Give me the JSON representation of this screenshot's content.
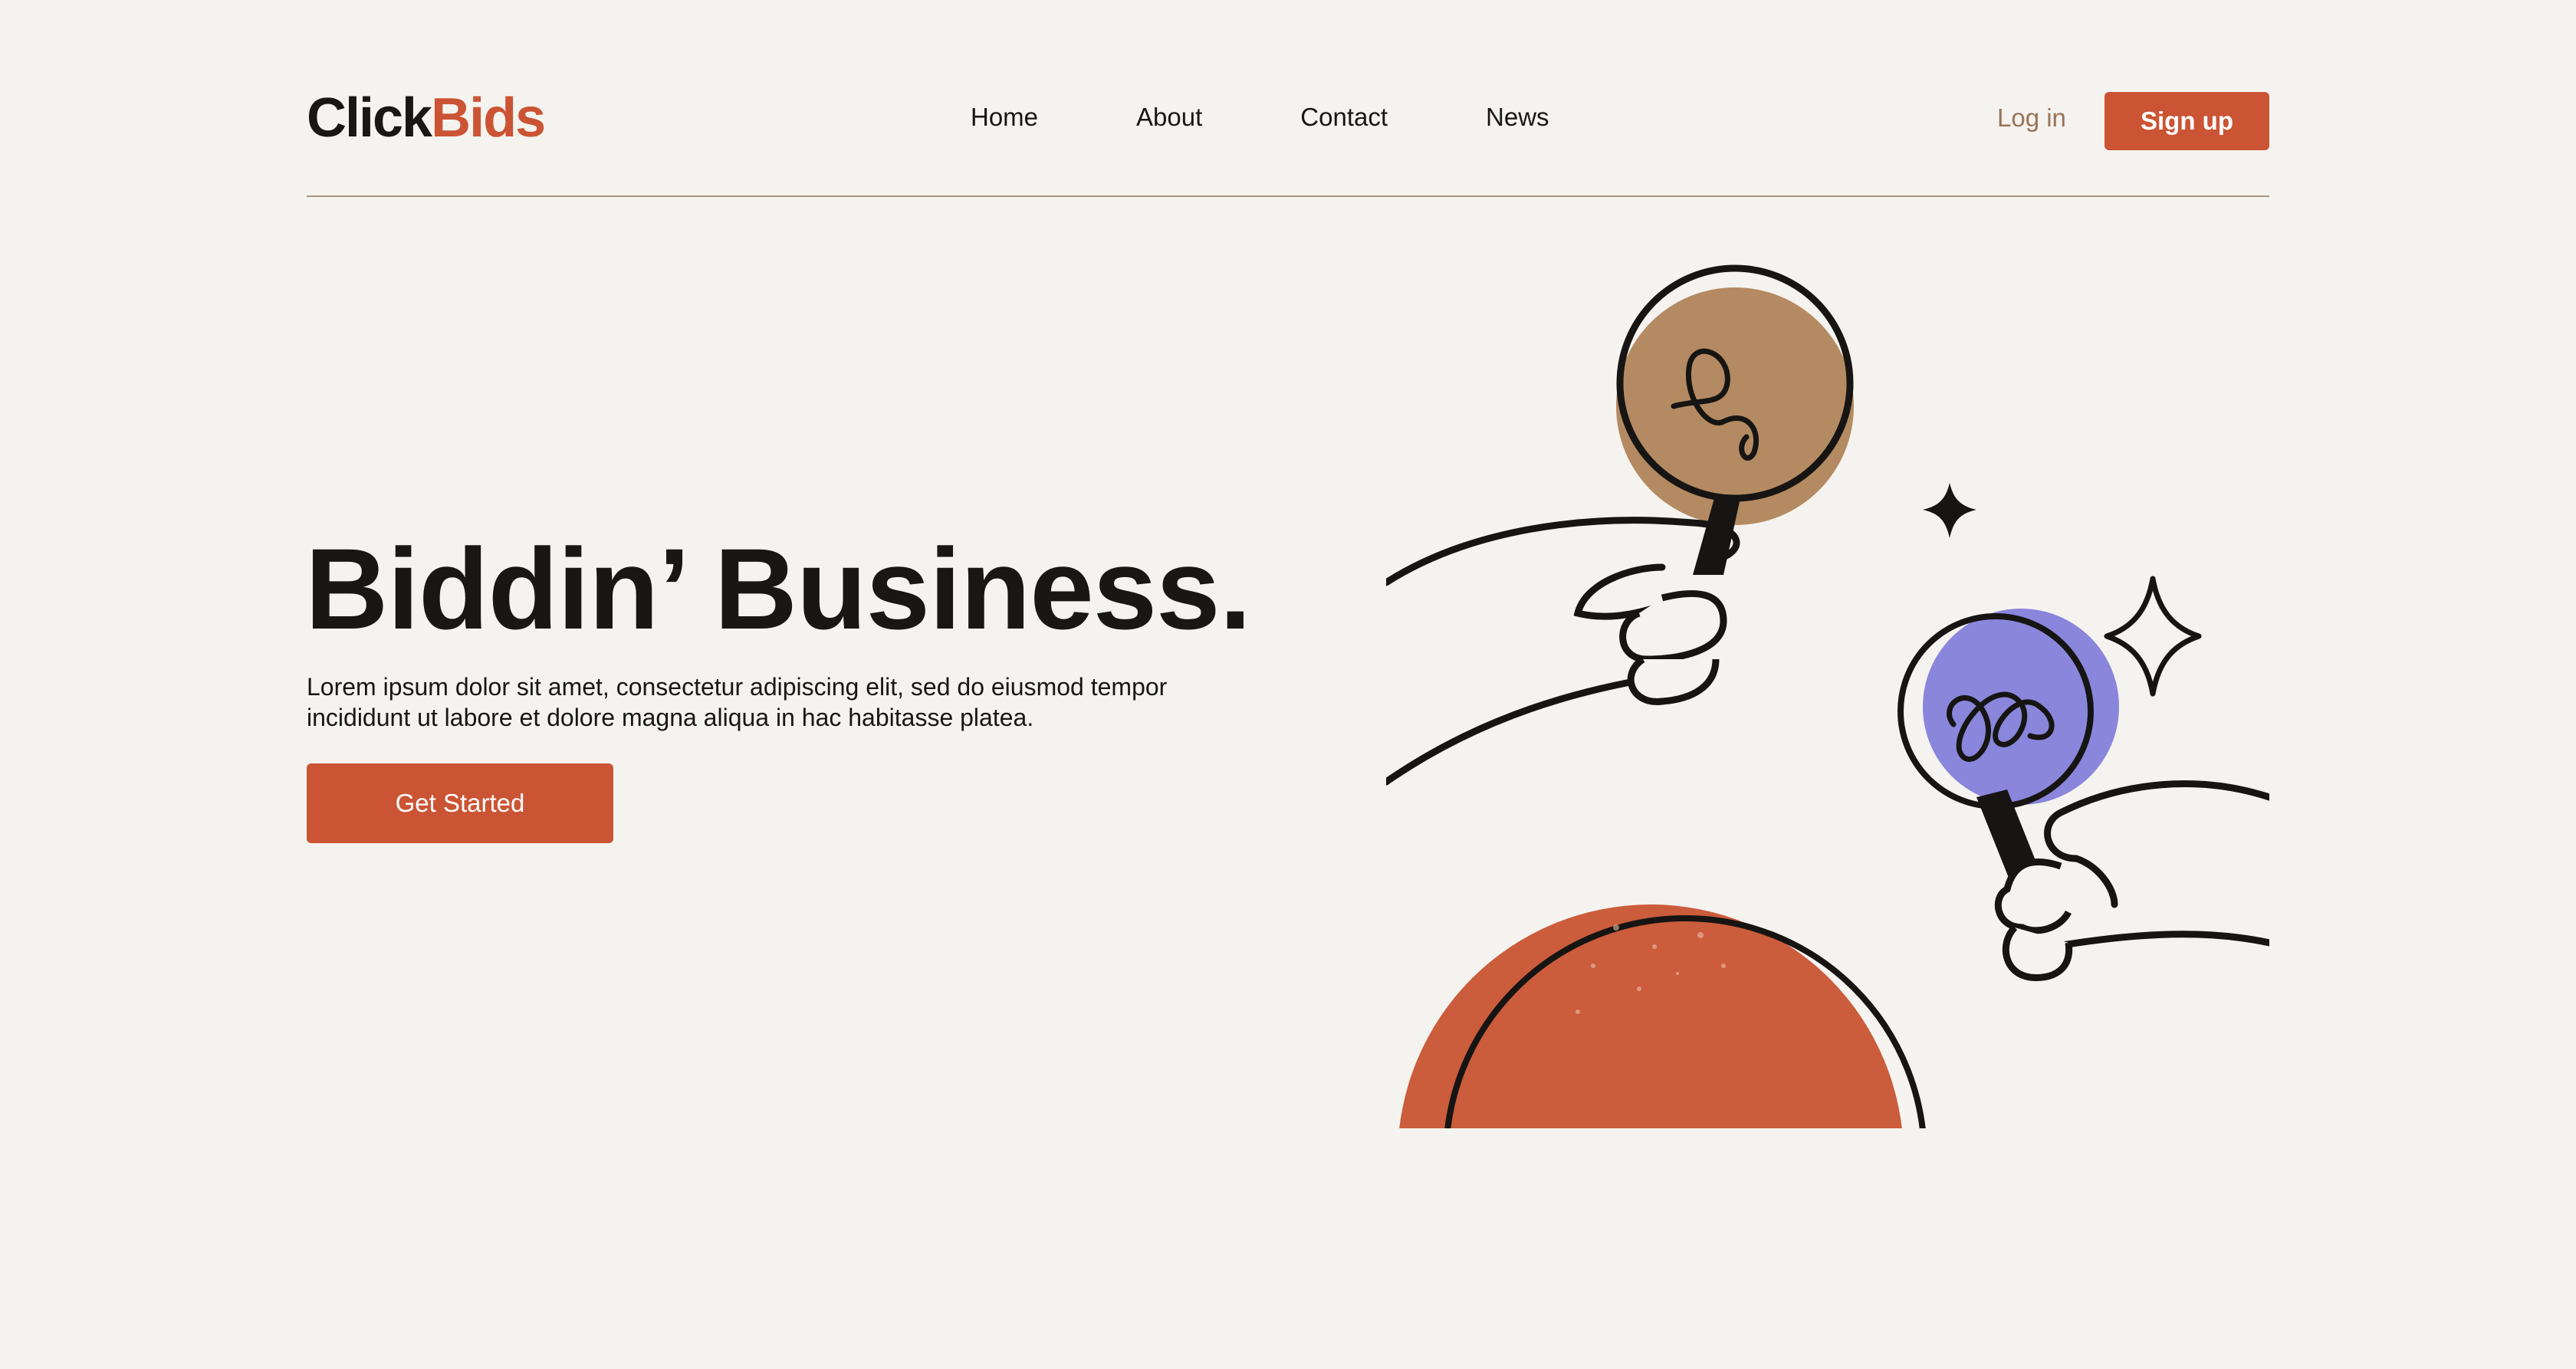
{
  "brand": {
    "name_part1": "Click",
    "name_part2": "Bids",
    "accent_color": "#cb5434"
  },
  "nav": {
    "items": [
      {
        "label": "Home"
      },
      {
        "label": "About"
      },
      {
        "label": "Contact"
      },
      {
        "label": "News"
      }
    ],
    "login_label": "Log in",
    "signup_label": "Sign up"
  },
  "hero": {
    "title": "Biddin’ Business.",
    "text": "Lorem ipsum dolor sit amet, consectetur adipiscing elit, sed do eiusmod tempor incididunt ut labore et dolore magna aliqua in hac habitasse platea.",
    "cta_label": "Get Started"
  },
  "illustration": {
    "paddle_colors": [
      "#b48a62",
      "#8a86dc",
      "#cb5c3c"
    ]
  }
}
